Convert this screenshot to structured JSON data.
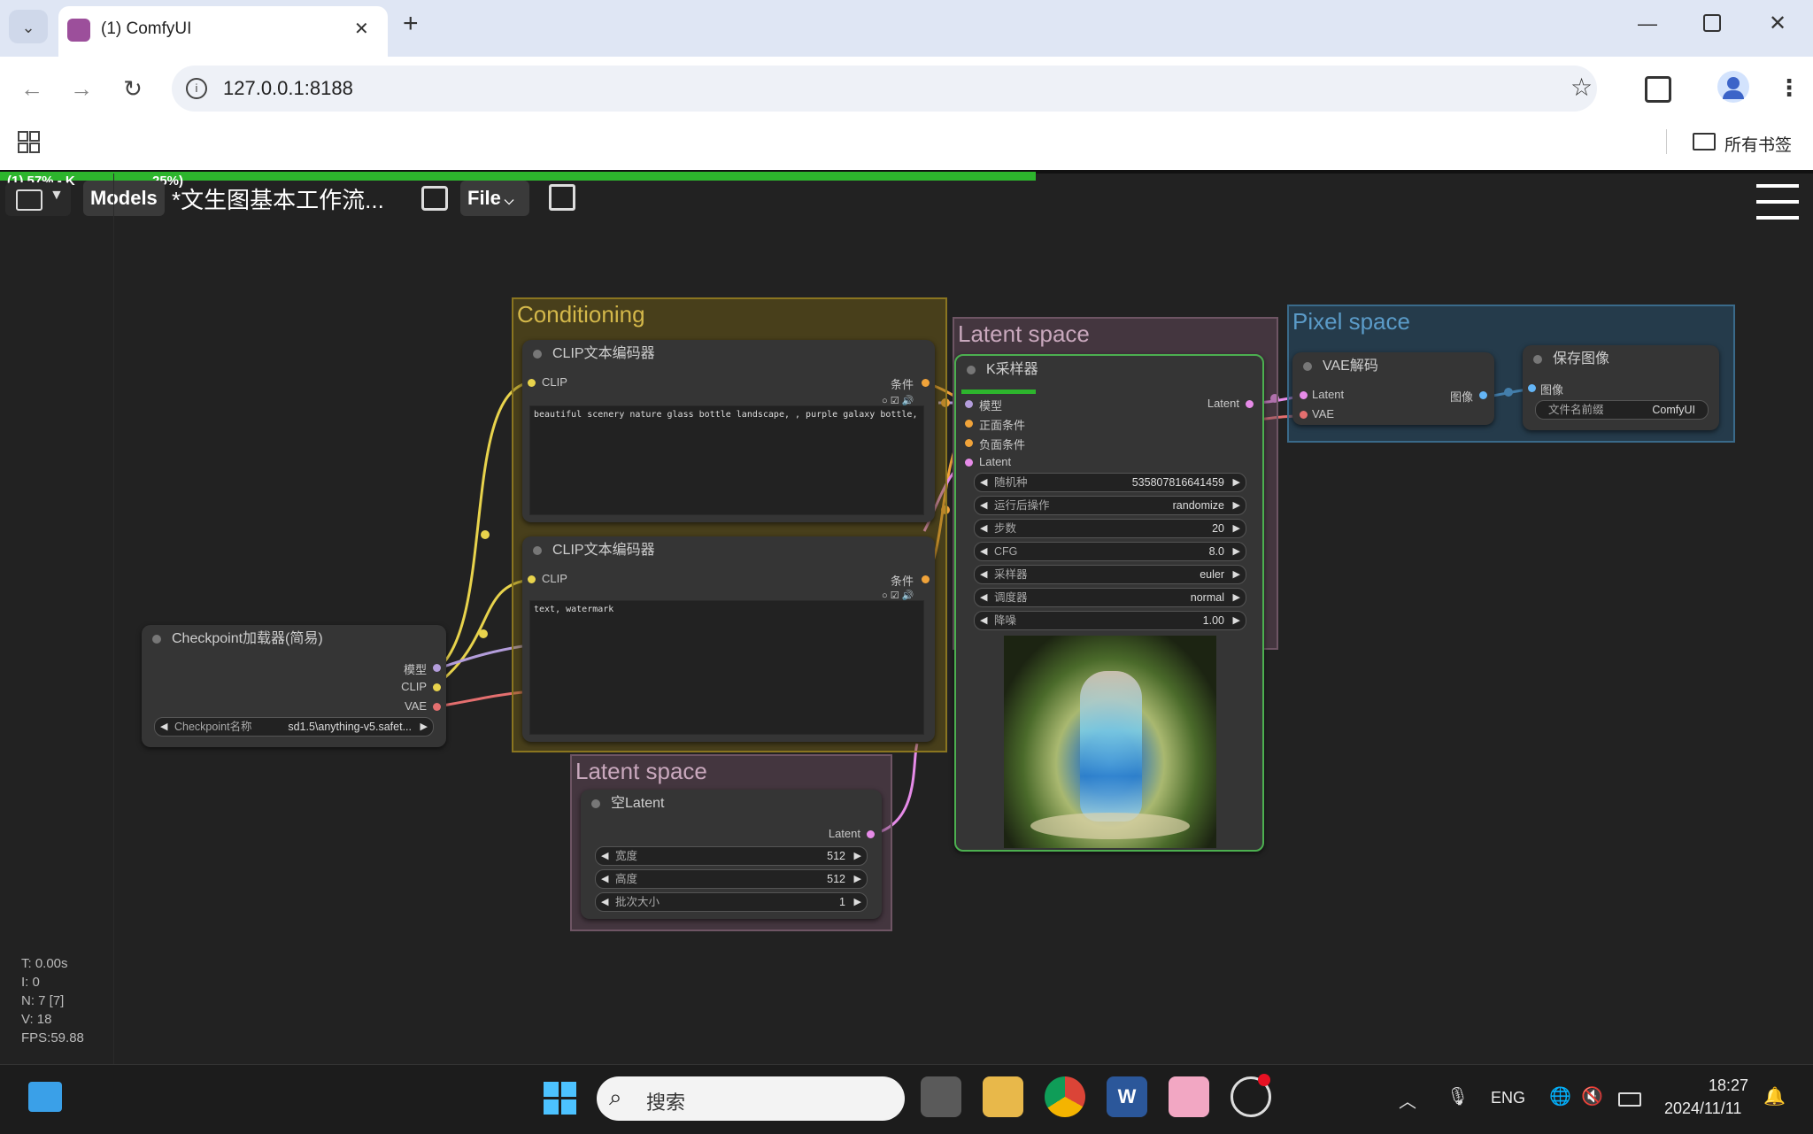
{
  "browser": {
    "tab_title": "(1) ComfyUI",
    "url": "127.0.0.1:8188",
    "bookmarks_label": "所有书签",
    "close_tab": "✕",
    "new_tab": "+"
  },
  "comfy": {
    "progress_text": "(1) 57% - K",
    "progress_text_tail": "25%)",
    "progress_value": 0.57,
    "models_label": "Models",
    "workflow_name": "*文生图基本工作流...",
    "file_label": "File"
  },
  "groups": {
    "conditioning": "Conditioning",
    "latent_space_top": "Latent space",
    "pixel_space": "Pixel space",
    "latent_space_bottom": "Latent space"
  },
  "nodes": {
    "clip_pos": {
      "title": "CLIP文本编码器",
      "input": "CLIP",
      "output": "条件",
      "text": "beautiful scenery nature glass bottle landscape, , purple galaxy bottle,"
    },
    "clip_neg": {
      "title": "CLIP文本编码器",
      "input": "CLIP",
      "output": "条件",
      "text": "text, watermark"
    },
    "checkpoint": {
      "title": "Checkpoint加载器(简易)",
      "out_model": "模型",
      "out_clip": "CLIP",
      "out_vae": "VAE",
      "widget_label": "Checkpoint名称",
      "widget_value": "sd1.5\\anything-v5.safet..."
    },
    "empty_latent": {
      "title": "空Latent",
      "output": "Latent",
      "widgets": [
        {
          "label": "宽度",
          "value": "512"
        },
        {
          "label": "高度",
          "value": "512"
        },
        {
          "label": "批次大小",
          "value": "1"
        }
      ]
    },
    "ksampler": {
      "title": "K采样器",
      "inputs": [
        "模型",
        "正面条件",
        "负面条件",
        "Latent"
      ],
      "output": "Latent",
      "widgets": [
        {
          "label": "随机种",
          "value": "535807816641459"
        },
        {
          "label": "运行后操作",
          "value": "randomize"
        },
        {
          "label": "步数",
          "value": "20"
        },
        {
          "label": "CFG",
          "value": "8.0"
        },
        {
          "label": "采样器",
          "value": "euler"
        },
        {
          "label": "调度器",
          "value": "normal"
        },
        {
          "label": "降噪",
          "value": "1.00"
        }
      ]
    },
    "vae_decode": {
      "title": "VAE解码",
      "in_latent": "Latent",
      "in_vae": "VAE",
      "output": "图像"
    },
    "save_image": {
      "title": "保存图像",
      "input": "图像",
      "widget_label": "文件名前缀",
      "widget_value": "ComfyUI"
    }
  },
  "stats": {
    "t": "T: 0.00s",
    "i": "I: 0",
    "n": "N: 7 [7]",
    "v": "V: 18",
    "fps": "FPS:59.88"
  },
  "taskbar": {
    "search_placeholder": "搜索",
    "lang": "ENG",
    "time": "18:27",
    "date": "2024/11/11"
  },
  "colors": {
    "clip": "#e8d34c",
    "model": "#b39ddb",
    "vae": "#e46f6f",
    "latent": "#e68be8",
    "conditioning": "#f0a33a",
    "image": "#64b5f6",
    "progress": "#2db52d"
  }
}
